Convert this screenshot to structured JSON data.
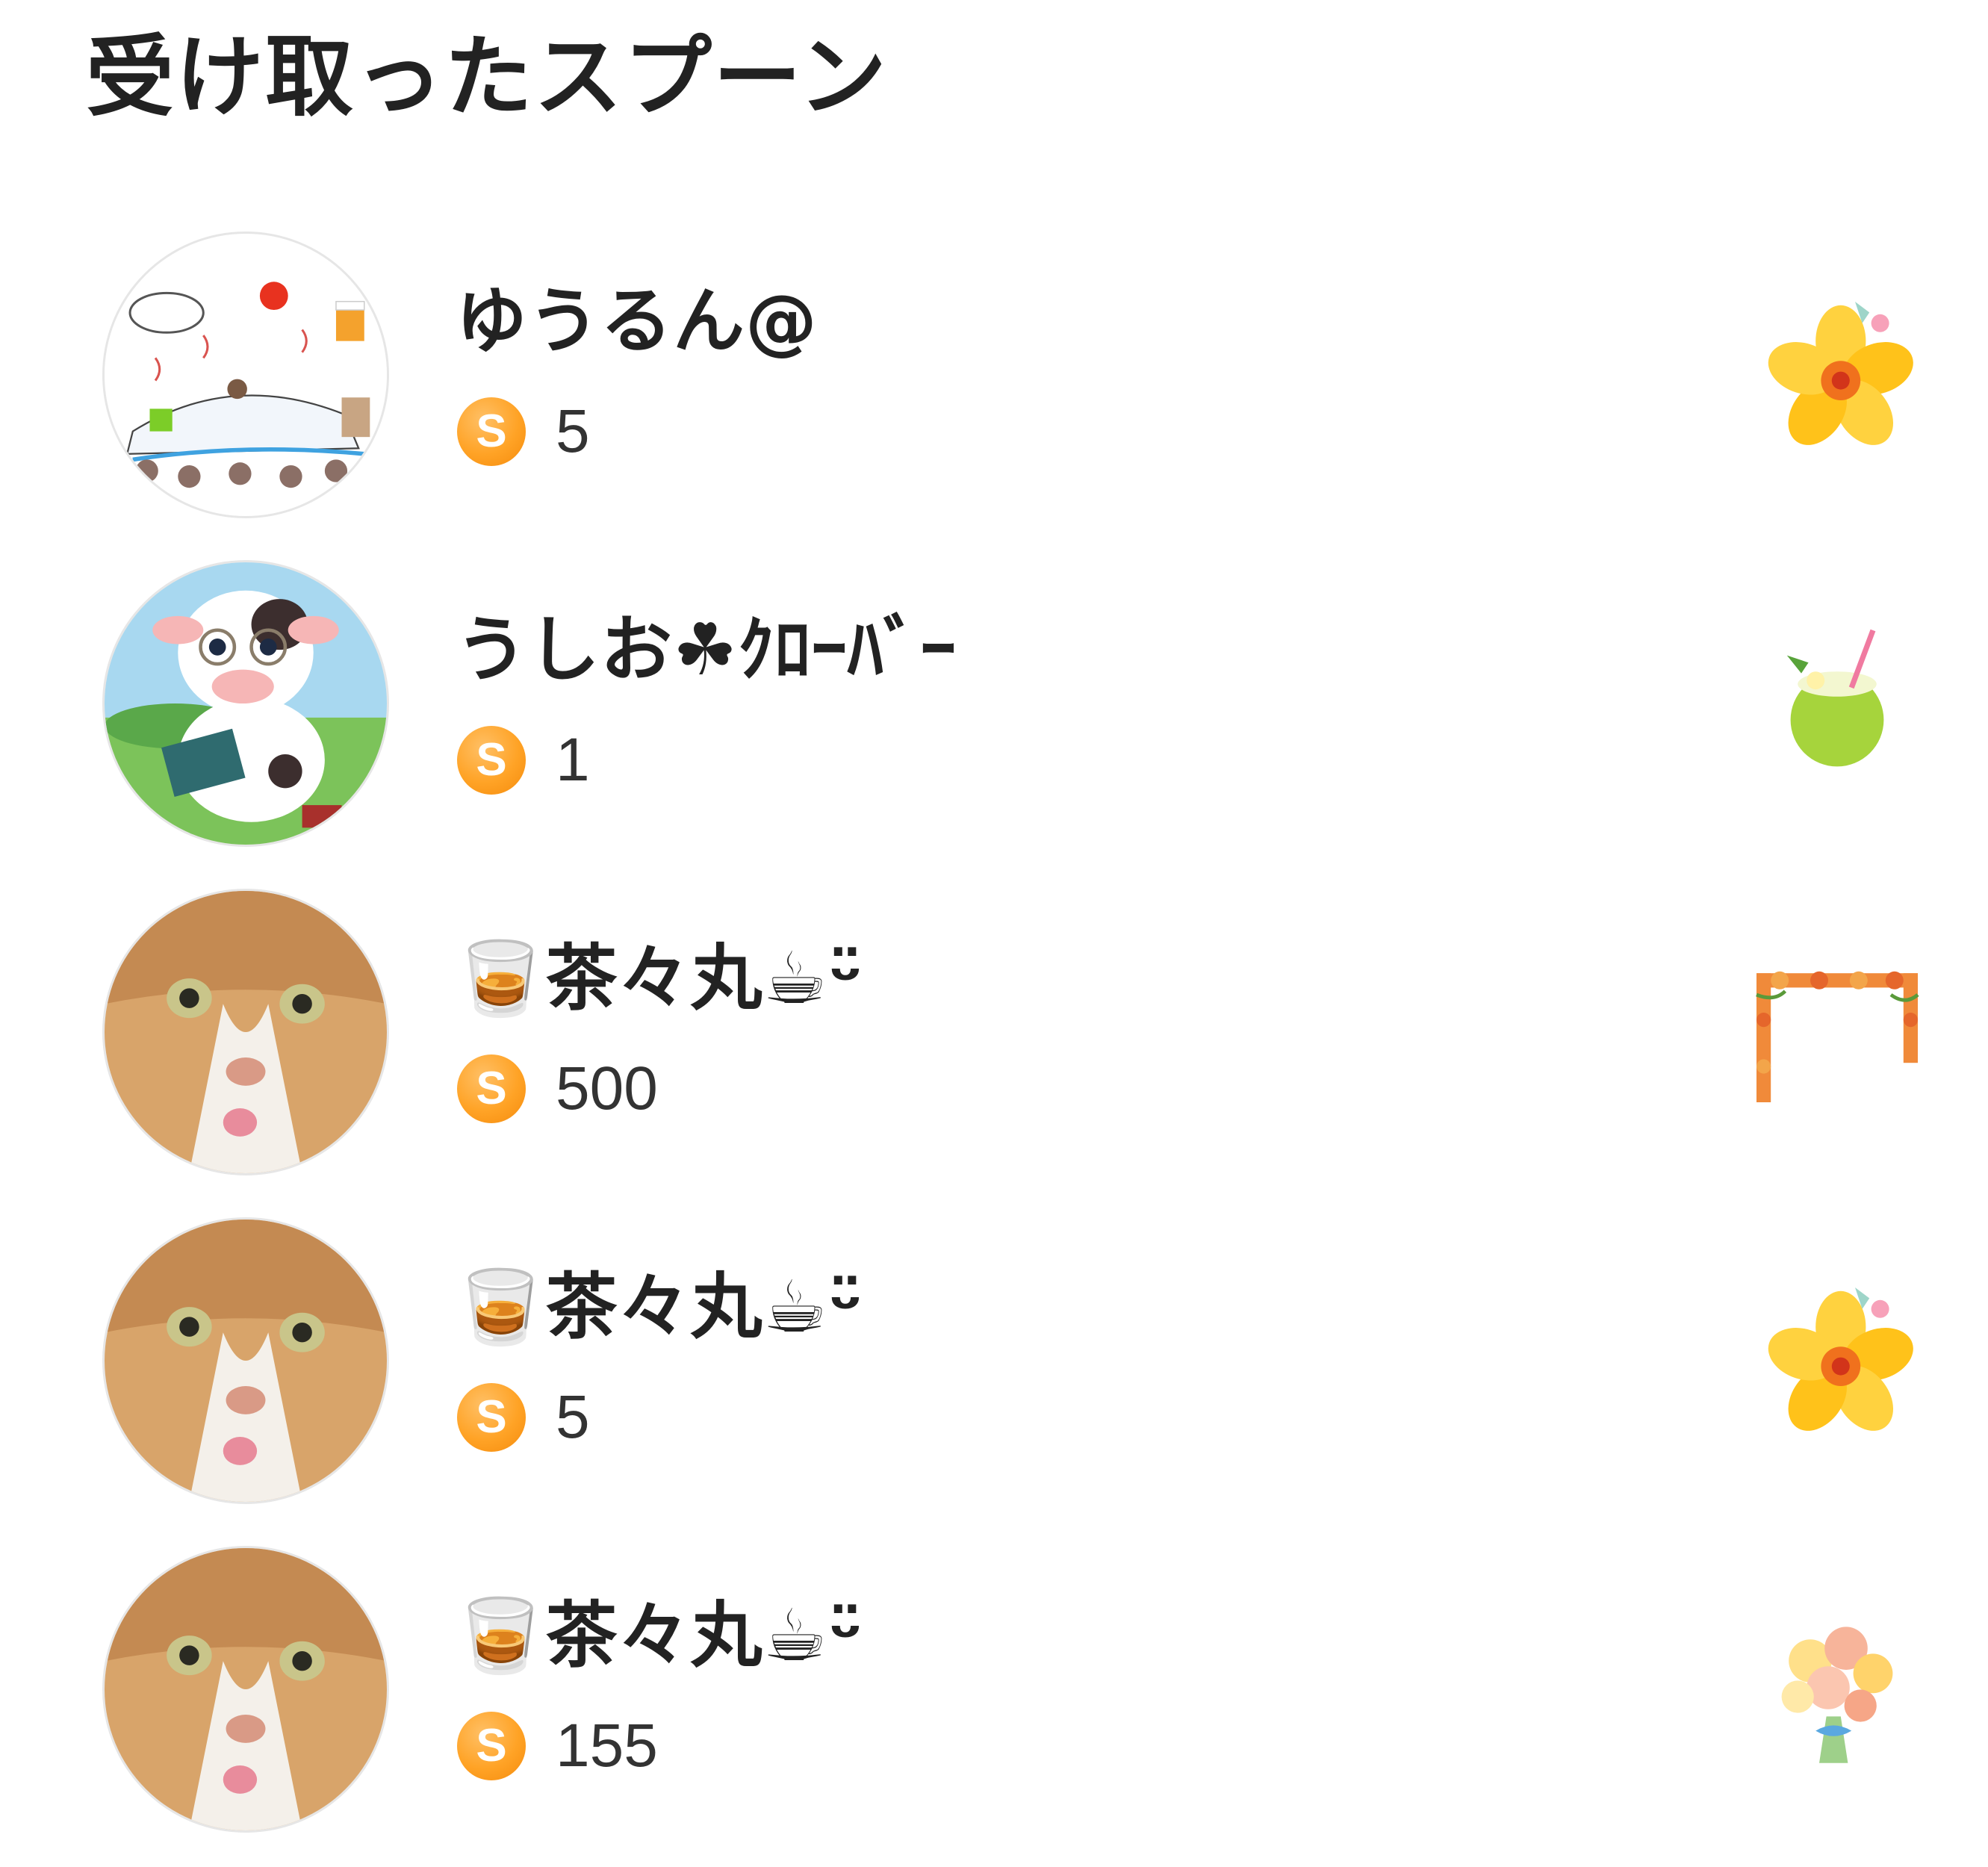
{
  "page": {
    "title": "受け取ったスプーン"
  },
  "spoon_badge_letter": "S",
  "accent_color": "#ffa326",
  "items": [
    {
      "username": "ゆうるん@",
      "spoons": "5",
      "avatar_icon": "onsen-illustration-avatar",
      "sticker_icon": "hibiscus-sticker"
    },
    {
      "username": "うしお☘ｸﾛｰﾊﾞｰ",
      "spoons": "1",
      "avatar_icon": "cow-reading-book-avatar",
      "sticker_icon": "coconut-drink-sticker"
    },
    {
      "username": "🥃茶々丸☕︎ᵕ̈",
      "spoons": "500",
      "avatar_icon": "cat-face-avatar",
      "sticker_icon": "flower-frame-sticker"
    },
    {
      "username": "🥃茶々丸☕︎ᵕ̈",
      "spoons": "5",
      "avatar_icon": "cat-face-avatar",
      "sticker_icon": "hibiscus-sticker"
    },
    {
      "username": "🥃茶々丸☕︎ᵕ̈",
      "spoons": "155",
      "avatar_icon": "cat-face-avatar",
      "sticker_icon": "bouquet-sticker"
    }
  ]
}
